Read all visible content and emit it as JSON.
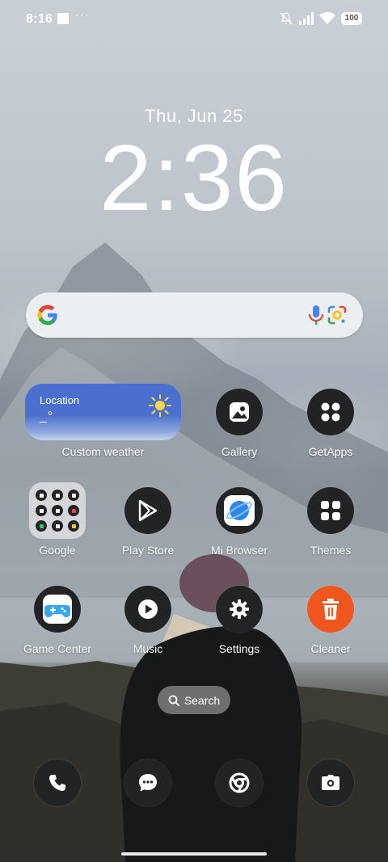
{
  "status_bar": {
    "time": "8:16",
    "overflow": "···",
    "battery": "100",
    "icons": [
      "notification-square-icon",
      "mute-icon",
      "signal-icon",
      "wifi-icon",
      "battery-icon"
    ]
  },
  "clock": {
    "date": "Thu, Jun 25",
    "time": "2:36"
  },
  "search_bar": {
    "icons": [
      "google-logo-icon",
      "microphone-icon",
      "google-lens-icon"
    ]
  },
  "weather_widget": {
    "location": "Location",
    "temperature": "_°",
    "label": "Custom weather"
  },
  "apps": [
    {
      "label": "Gallery",
      "icon": "gallery-icon"
    },
    {
      "label": "GetApps",
      "icon": "getapps-icon"
    },
    {
      "label": "Google",
      "icon": "google-folder-icon"
    },
    {
      "label": "Play Store",
      "icon": "play-store-icon"
    },
    {
      "label": "Mi Browser",
      "icon": "mi-browser-icon"
    },
    {
      "label": "Themes",
      "icon": "themes-icon"
    },
    {
      "label": "Game Center",
      "icon": "game-center-icon"
    },
    {
      "label": "Music",
      "icon": "music-icon"
    },
    {
      "label": "Settings",
      "icon": "settings-icon"
    },
    {
      "label": "Cleaner",
      "icon": "cleaner-icon"
    }
  ],
  "app_search": {
    "label": "Search"
  },
  "dock": [
    "phone-icon",
    "messages-icon",
    "chrome-icon",
    "camera-icon"
  ],
  "colors": {
    "weather_top": "#4a6fd0",
    "cleaner": "#f0571f",
    "game_center": "#3aa7f5",
    "mi_browser": "#2f86ea",
    "app_bg": "#222325"
  }
}
